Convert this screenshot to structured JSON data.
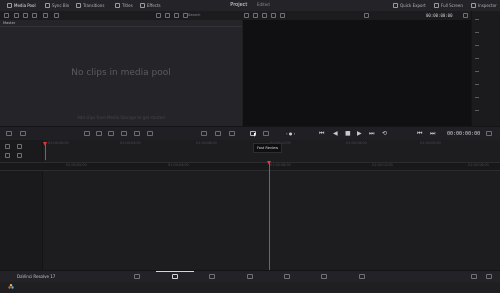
{
  "top_tabs": [
    {
      "label": "Media Pool",
      "active": true
    },
    {
      "label": "Sync Bin",
      "active": false
    },
    {
      "label": "Transitions",
      "active": false
    },
    {
      "label": "Titles",
      "active": false
    },
    {
      "label": "Effects",
      "active": false
    }
  ],
  "project": {
    "title": "Project",
    "status": "Edited"
  },
  "right_tabs": [
    {
      "label": "Quick Export"
    },
    {
      "label": "Full Screen"
    },
    {
      "label": "Inspector"
    }
  ],
  "media_pool": {
    "header": "Master",
    "search_label": "Search",
    "empty_title": "No clips in media pool",
    "empty_subtitle": "Add clips from Media Storage to get started"
  },
  "viewer": {
    "timecode": "00:00:00:00"
  },
  "transport": {
    "timecode": "00:00:00:00"
  },
  "tooltip": "Fast Review",
  "ruler_marks": [
    "01:00:00:00",
    "01:00:04:00",
    "01:00:08:00",
    "01:00:12:00",
    "01:00:16:00",
    "01:00:20:00"
  ],
  "track_marks": [
    "01:00:00:00",
    "01:00:04:00",
    "01:00:08:00",
    "01:00:12:00",
    "01:00:16:00"
  ],
  "app": {
    "name": "DaVinci Resolve 17"
  },
  "colors": {
    "playhead": "#e2343a",
    "background": "#1f1f22"
  }
}
